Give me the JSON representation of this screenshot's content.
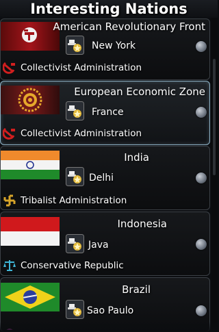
{
  "panel": {
    "title": "Interesting Nations"
  },
  "nations": [
    {
      "name": "American Revolutionary Front",
      "capital": "New York",
      "government": "Collectivist Administration",
      "flag_icon": "hammer-sickle-red-flag-icon",
      "gov_icon": "hammer-sickle-icon"
    },
    {
      "name": "European Economic Zone",
      "capital": "France",
      "government": "Collectivist Administration",
      "flag_icon": "eez-gear-emblem-flag-icon",
      "gov_icon": "hammer-sickle-icon"
    },
    {
      "name": "India",
      "capital": "Delhi",
      "government": "Tribalist Administration",
      "flag_icon": "india-flag-icon",
      "gov_icon": "swastika-icon"
    },
    {
      "name": "Indonesia",
      "capital": "Java",
      "government": "Conservative Republic",
      "flag_icon": "indonesia-flag-icon",
      "gov_icon": "scales-icon"
    },
    {
      "name": "Brazil",
      "capital": "Sao Paulo",
      "government": "",
      "flag_icon": "brazil-flag-icon",
      "gov_icon": "partial-icon"
    }
  ],
  "colors": {
    "selected_border": "#8fb3c7",
    "hammer_sickle": "#d11f1f",
    "swastika": "#d7a52a",
    "scales": "#3fb6d8"
  }
}
